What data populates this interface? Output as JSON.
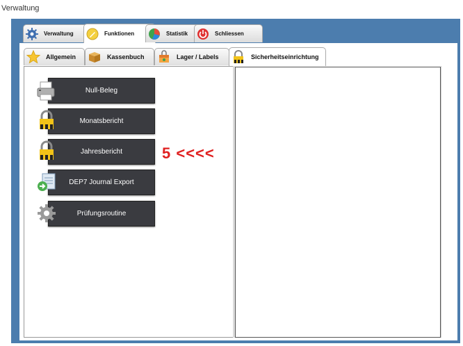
{
  "window": {
    "title": "Verwaltung"
  },
  "main_tabs": [
    {
      "label": "Verwaltung",
      "icon": "gear-icon"
    },
    {
      "label": "Funktionen",
      "icon": "pencil-icon",
      "active": true
    },
    {
      "label": "Statistik",
      "icon": "pie-chart-icon"
    },
    {
      "label": "Schliessen",
      "icon": "power-icon"
    }
  ],
  "sub_tabs": [
    {
      "label": "Allgemein",
      "icon": "star-icon"
    },
    {
      "label": "Kassenbuch",
      "icon": "box-icon"
    },
    {
      "label": "Lager / Labels",
      "icon": "shopping-bag-icon"
    },
    {
      "label": "Sicherheitseinrichtung",
      "icon": "padlock-icon",
      "active": true
    }
  ],
  "functions": [
    {
      "label": "Null-Beleg",
      "icon": "printer-icon"
    },
    {
      "label": "Monatsbericht",
      "icon": "padlock-icon"
    },
    {
      "label": "Jahresbericht",
      "icon": "padlock-icon"
    },
    {
      "label": "DEP7 Journal Export",
      "icon": "export-document-icon"
    },
    {
      "label": "Prüfungsroutine",
      "icon": "gear-icon"
    }
  ],
  "annotation": "5 <<<<",
  "colors": {
    "frame": "#4c7dae",
    "button": "#3a3b40",
    "annotation": "#e02020"
  }
}
